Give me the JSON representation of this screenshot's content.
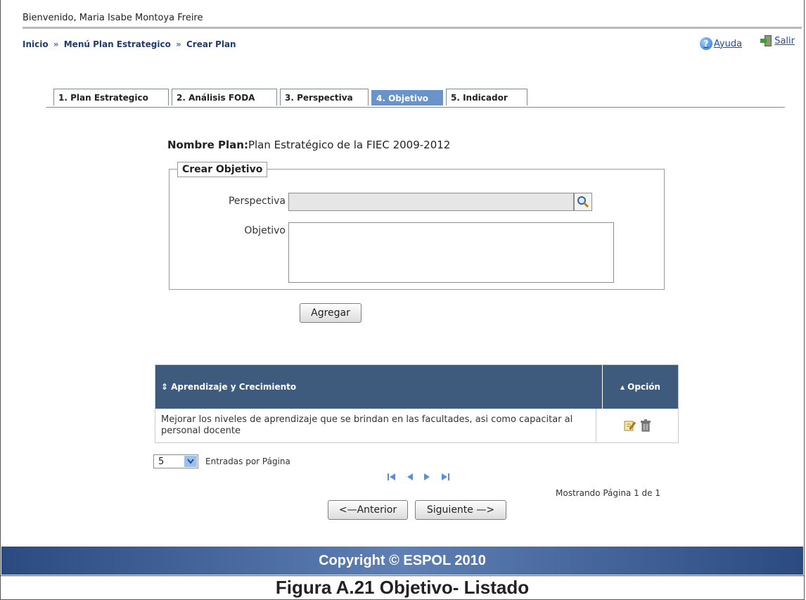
{
  "header": {
    "welcome": "Bienvenido, Maria Isabe Montoya Freire",
    "breadcrumb": [
      "Inicio",
      "Menú Plan Estrategico",
      "Crear Plan"
    ],
    "separator": "»",
    "help_label": "Ayuda",
    "help_icon": "help-icon",
    "exit_label": "Salir",
    "exit_icon": "exit-icon"
  },
  "tabs": [
    {
      "label": "1. Plan Estrategico",
      "active": false
    },
    {
      "label": "2. Análisis FODA",
      "active": false
    },
    {
      "label": "3. Perspectiva",
      "active": false
    },
    {
      "label": "4. Objetivo",
      "active": true
    },
    {
      "label": "5. Indicador",
      "active": false
    }
  ],
  "plan": {
    "label": "Nombre Plan:",
    "value": "Plan Estratégico de la FIEC 2009-2012"
  },
  "form": {
    "legend": "Crear Objetivo",
    "perspectiva_label": "Perspectiva",
    "perspectiva_value": "",
    "objetivo_label": "Objetivo",
    "objetivo_value": "",
    "add_label": "Agregar"
  },
  "table": {
    "headers": [
      "Aprendizaje y Crecimiento",
      "Opción"
    ],
    "header_sort_icons": [
      "sort-both-icon",
      "sort-asc-icon"
    ],
    "rows": [
      {
        "text": "Mejorar los niveles de aprendizaje que se brindan en las facultades, asi como capacitar al personal docente",
        "actions": [
          "edit-icon",
          "delete-icon"
        ]
      }
    ]
  },
  "pagination": {
    "page_size": "5",
    "per_page_label": "Entradas por Página",
    "showing": "Mostrando Página 1 de 1",
    "prev_label": "<—Anterior",
    "next_label": "Siguiente —>"
  },
  "footer": {
    "copyright": "Copyright © ESPOL 2010"
  },
  "caption": "Figura A.21 Objetivo- Listado",
  "colors": {
    "tab_active": "#6a93c9",
    "grid_header": "#3e5b7d",
    "footer": "#2a4a80",
    "link": "#1d4fa0"
  }
}
